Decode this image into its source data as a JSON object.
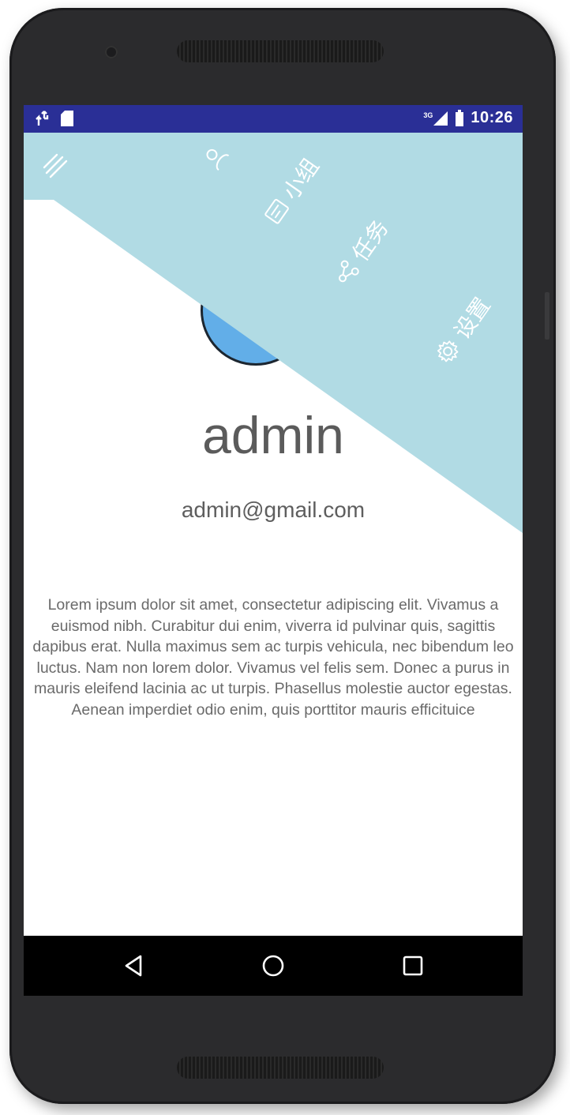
{
  "status_bar": {
    "time": "10:26",
    "network": "3G",
    "background_color": "#2a2f96",
    "left_icons": [
      "usb-debug-icon",
      "sd-card-icon"
    ],
    "right_icons": [
      "signal-icon",
      "battery-icon"
    ]
  },
  "header": {
    "background_color": "#b1dbe4",
    "menu_icon": "hamburger-menu-icon",
    "menu_items": [
      {
        "label": "",
        "icon": "person-icon"
      },
      {
        "label": "小组",
        "icon": "group-card-icon"
      },
      {
        "label": "任务",
        "icon": "share-nodes-icon"
      },
      {
        "label": "设置",
        "icon": "gear-icon"
      }
    ]
  },
  "profile": {
    "avatar_color": "#62aee8",
    "name": "admin",
    "email": "admin@gmail.com",
    "bio": "Lorem ipsum dolor sit amet, consectetur adipiscing elit. Vivamus a euismod nibh. Curabitur dui enim, viverra id pulvinar quis, sagittis dapibus erat. Nulla maximus sem ac turpis vehicula, nec bibendum leo luctus. Nam non lorem dolor. Vivamus vel felis sem. Donec a purus in mauris eleifend lacinia ac ut turpis. Phasellus molestie auctor egestas. Aenean imperdiet odio enim, quis porttitor mauris efficituice"
  },
  "nav_bar": {
    "buttons": [
      "back-icon",
      "home-icon",
      "recents-icon"
    ]
  }
}
